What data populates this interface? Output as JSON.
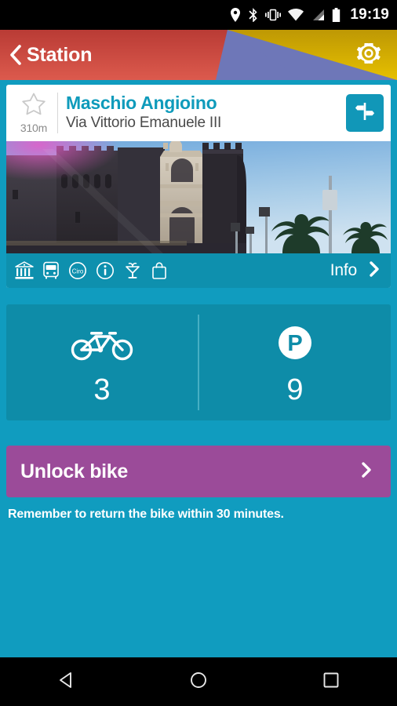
{
  "statusbar": {
    "time": "19:19",
    "icons": [
      "location-pin-icon",
      "bluetooth-icon",
      "vibrate-icon",
      "wifi-icon",
      "cellular-signal-icon",
      "battery-icon"
    ]
  },
  "appbar": {
    "back_label": "Station",
    "back_icon": "chevron-left-icon",
    "settings_icon": "gear-icon",
    "colors": {
      "red_dark": "#C2423A",
      "red_light": "#D9554A",
      "gold_dark": "#C19B05",
      "gold_light": "#E3BB00",
      "blue": "#6E77B8"
    }
  },
  "station": {
    "name": "Maschio Angioino",
    "address": "Via Vittorio Emanuele III",
    "distance": "310m",
    "favorite_icon": "star-outline-icon",
    "directions_icon": "signpost-icon",
    "photo_alt": "Castel Nuovo Maschio Angioino"
  },
  "amenities": {
    "items": [
      {
        "icon": "museum-icon",
        "label": "Museum"
      },
      {
        "icon": "bus-icon",
        "label": "Bus"
      },
      {
        "icon": "ciro-badge-icon",
        "label": "Ciro"
      },
      {
        "icon": "info-circle-icon",
        "label": "Information"
      },
      {
        "icon": "drink-glass-icon",
        "label": "Food and drink"
      },
      {
        "icon": "shopping-bag-icon",
        "label": "Shopping"
      }
    ],
    "info_label": "Info",
    "info_chevron": "chevron-right-icon"
  },
  "counts": {
    "bikes": {
      "icon": "bicycle-icon",
      "value": "3",
      "label": "Bikes available"
    },
    "parking": {
      "icon": "parking-p-icon",
      "value": "9",
      "label": "Free docks"
    }
  },
  "unlock": {
    "label": "Unlock bike",
    "chevron": "chevron-right-icon",
    "color": "#9B4B99"
  },
  "reminder": {
    "text": "Remember to return the bike within 30 minutes."
  },
  "navbar": {
    "back": "back-triangle-icon",
    "home": "home-circle-icon",
    "recents": "recents-square-icon"
  },
  "theme": {
    "page_bg": "#109CBF",
    "panel_bg": "#0E8CA8",
    "accent_teal": "#0F9BBB"
  }
}
